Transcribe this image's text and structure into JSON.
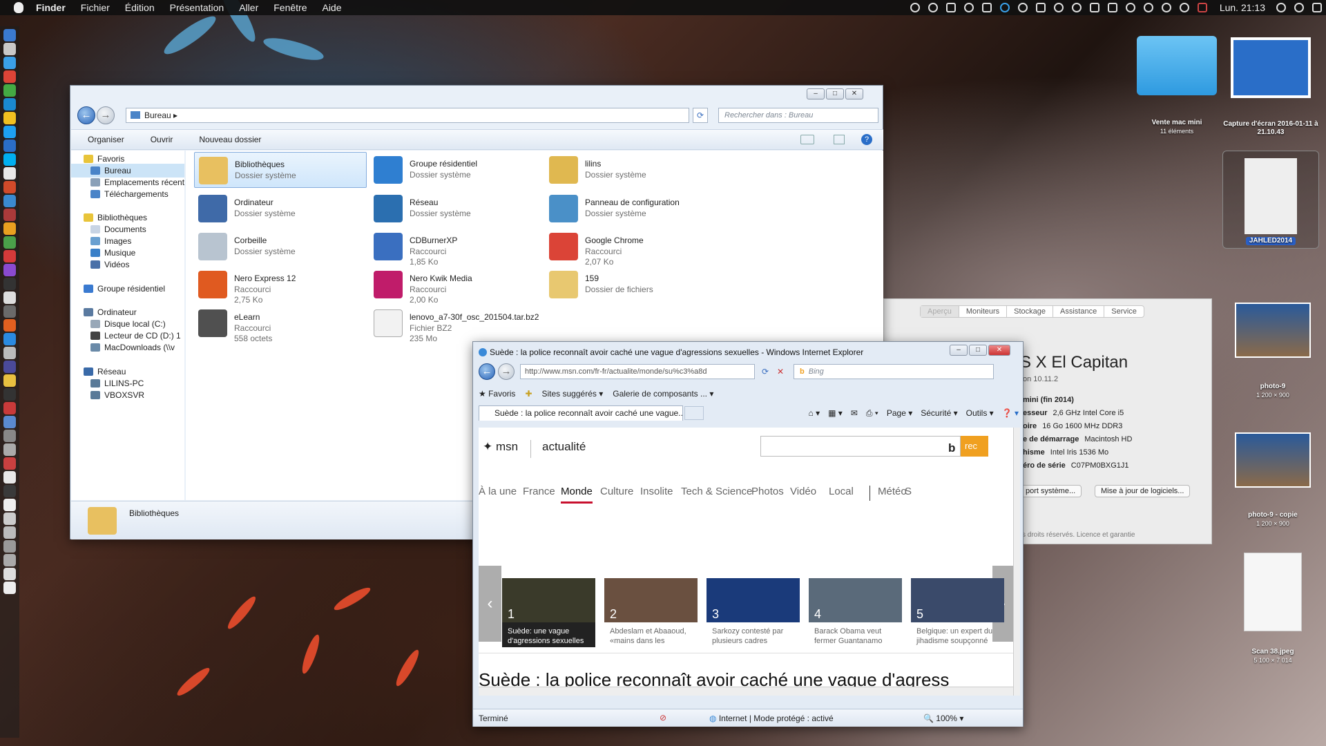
{
  "menubar": {
    "app": "Finder",
    "items": [
      "Fichier",
      "Édition",
      "Présentation",
      "Aller",
      "Fenêtre",
      "Aide"
    ],
    "clock": "Lun. 21:13"
  },
  "explorer": {
    "address": "Bureau",
    "search_placeholder": "Rechercher dans : Bureau",
    "toolbar": {
      "organize": "Organiser",
      "open": "Ouvrir",
      "new_folder": "Nouveau dossier"
    },
    "nav": [
      {
        "label": "Favoris",
        "indent": 0,
        "color": "#e8c43a"
      },
      {
        "label": "Bureau",
        "indent": 1,
        "color": "#4a84c8",
        "selected": true
      },
      {
        "label": "Emplacements récents",
        "indent": 1,
        "color": "#8aa0b8"
      },
      {
        "label": "Téléchargements",
        "indent": 1,
        "color": "#4a84c8"
      },
      {
        "label": "Bibliothèques",
        "indent": 0,
        "color": "#e8c43a"
      },
      {
        "label": "Documents",
        "indent": 1,
        "color": "#c8d4e4"
      },
      {
        "label": "Images",
        "indent": 1,
        "color": "#6aa0d0"
      },
      {
        "label": "Musique",
        "indent": 1,
        "color": "#3a80c8"
      },
      {
        "label": "Vidéos",
        "indent": 1,
        "color": "#4a70a8"
      },
      {
        "label": "Groupe résidentiel",
        "indent": 0,
        "color": "#3a7ad0"
      },
      {
        "label": "Ordinateur",
        "indent": 0,
        "color": "#5a7aa0"
      },
      {
        "label": "Disque local (C:)",
        "indent": 1,
        "color": "#98a8b8"
      },
      {
        "label": "Lecteur de CD (D:) 1",
        "indent": 1,
        "color": "#444444"
      },
      {
        "label": "MacDownloads (\\\\v",
        "indent": 1,
        "color": "#6a8aa8"
      },
      {
        "label": "Réseau",
        "indent": 0,
        "color": "#3a6aa8"
      },
      {
        "label": "LILINS-PC",
        "indent": 1,
        "color": "#5a7a98"
      },
      {
        "label": "VBOXSVR",
        "indent": 1,
        "color": "#5a7a98"
      }
    ],
    "items": [
      {
        "name": "Bibliothèques",
        "type": "Dossier système",
        "size": "",
        "color": "#e8c060",
        "selected": true
      },
      {
        "name": "Groupe résidentiel",
        "type": "Dossier système",
        "size": "",
        "color": "#2f7fd1"
      },
      {
        "name": "lilins",
        "type": "Dossier système",
        "size": "",
        "color": "#e0b850"
      },
      {
        "name": "Ordinateur",
        "type": "Dossier système",
        "size": "",
        "color": "#3f6aa8"
      },
      {
        "name": "Réseau",
        "type": "Dossier système",
        "size": "",
        "color": "#2b6fb0"
      },
      {
        "name": "Panneau de configuration",
        "type": "Dossier système",
        "size": "",
        "color": "#4a90c8"
      },
      {
        "name": "Corbeille",
        "type": "Dossier système",
        "size": "",
        "color": "#b8c4d0"
      },
      {
        "name": "CDBurnerXP",
        "type": "Raccourci",
        "size": "1,85 Ko",
        "color": "#3a6fc0"
      },
      {
        "name": "Google Chrome",
        "type": "Raccourci",
        "size": "2,07 Ko",
        "color": "#db4437"
      },
      {
        "name": "Nero Express 12",
        "type": "Raccourci",
        "size": "2,75 Ko",
        "color": "#e05a20"
      },
      {
        "name": "Nero Kwik Media",
        "type": "Raccourci",
        "size": "2,00 Ko",
        "color": "#c01c6a"
      },
      {
        "name": "159",
        "type": "Dossier de fichiers",
        "size": "",
        "color": "#e8c870"
      },
      {
        "name": "eLearn",
        "type": "Raccourci",
        "size": "558 octets",
        "color": "#505050"
      },
      {
        "name": "lenovo_a7-30f_osc_201504.tar.bz2",
        "type": "Fichier BZ2",
        "size": "235 Mo",
        "color": "#f2f2f2"
      }
    ],
    "details": {
      "name": "Bibliothèques"
    }
  },
  "about": {
    "tabs": [
      "Aperçu",
      "Moniteurs",
      "Stockage",
      "Assistance",
      "Service"
    ],
    "os_title": "S X El Capitan",
    "version": "on 10.11.2",
    "rows": [
      {
        "label": "mini (fin 2014)",
        "value": ""
      },
      {
        "label": "esseur",
        "value": "2,6 GHz Intel Core i5"
      },
      {
        "label": "oire",
        "value": "16 Go 1600 MHz DDR3"
      },
      {
        "label": "e de démarrage",
        "value": "Macintosh HD"
      },
      {
        "label": "hisme",
        "value": "Intel Iris 1536 Mo"
      },
      {
        "label": "éro de série",
        "value": "C07PM0BXG1J1"
      }
    ],
    "btn_report": "port système...",
    "btn_update": "Mise à jour de logiciels...",
    "footer": "s droits réservés. Licence et garantie"
  },
  "ie": {
    "title": "Suède : la police reconnaît avoir caché une vague d'agressions sexuelles - Windows Internet Explorer",
    "url": "http://www.msn.com/fr-fr/actualite/monde/su%c3%a8d",
    "search_placeholder": "Bing",
    "favbar": {
      "fav": "Favoris",
      "suggested": "Sites suggérés",
      "gallery": "Galerie de composants ..."
    },
    "tab": "Suède : la police reconnaît avoir caché une vague...",
    "cmd": {
      "page": "Page",
      "security": "Sécurité",
      "tools": "Outils"
    },
    "msn": {
      "logo": "msn",
      "section": "actualité",
      "search_btn": "rec"
    },
    "categories": [
      "À la une",
      "France",
      "Monde",
      "Culture",
      "Insolite",
      "Tech & Science",
      "Photos",
      "Vidéo",
      "Local",
      "Météo",
      "S"
    ],
    "stories": [
      {
        "num": "1",
        "caption": "Suède: une vague d'agressions sexuelles",
        "color": "#3a3a2a",
        "active": true
      },
      {
        "num": "2",
        "caption": "Abdeslam et Abaaoud, «mains dans les",
        "color": "#6a5040"
      },
      {
        "num": "3",
        "caption": "Sarkozy contesté par plusieurs cadres",
        "color": "#1a3a7a"
      },
      {
        "num": "4",
        "caption": "Barack Obama veut fermer Guantanamo",
        "color": "#5a6a7a"
      },
      {
        "num": "5",
        "caption": "Belgique: un expert du jihadisme soupçonné",
        "color": "#3a4a6a"
      }
    ],
    "headline": "Suède : la police reconnaît avoir caché une vague d'agress",
    "status": {
      "done": "Terminé",
      "zone": "Internet | Mode protégé : activé",
      "zoom": "100%"
    }
  },
  "desktop": [
    {
      "name": "Vente mac mini",
      "sub": "11 éléments"
    },
    {
      "name": "Capture d'écran 2016-01-11 à 21.10.43",
      "sub": ""
    },
    {
      "name": "JAHLED2014",
      "sub": ""
    },
    {
      "name": "photo-9",
      "sub": "1 200 × 900"
    },
    {
      "name": "photo-9 - copie",
      "sub": "1 200 × 900"
    },
    {
      "name": "Scan 38.jpeg",
      "sub": "5 100 × 7 014"
    }
  ]
}
